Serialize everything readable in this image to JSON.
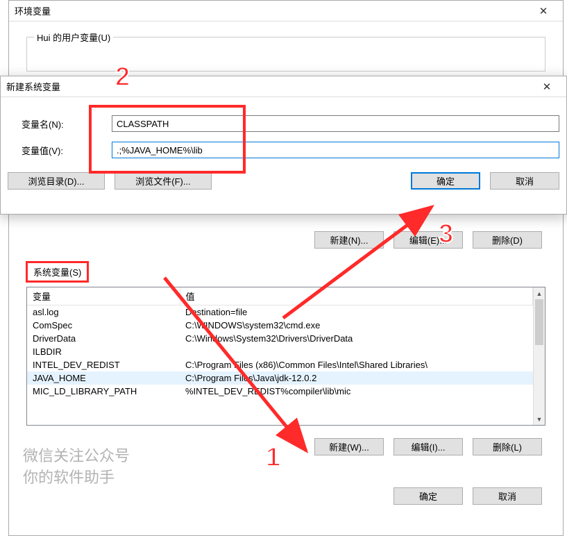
{
  "env_dialog": {
    "title": "环境变量",
    "user_section_label": "Hui 的用户变量(U)",
    "user_buttons": {
      "new": "新建(N)...",
      "edit": "编辑(E)...",
      "delete": "删除(D)"
    },
    "sys_section_label": "系统变量(S)",
    "sys_table": {
      "headers": {
        "name": "变量",
        "value": "值"
      },
      "rows": [
        {
          "name": "asl.log",
          "value": "Destination=file"
        },
        {
          "name": "ComSpec",
          "value": "C:\\WINDOWS\\system32\\cmd.exe"
        },
        {
          "name": "DriverData",
          "value": "C:\\Windows\\System32\\Drivers\\DriverData"
        },
        {
          "name": "ILBDIR",
          "value": ""
        },
        {
          "name": "INTEL_DEV_REDIST",
          "value": "C:\\Program Files (x86)\\Common Files\\Intel\\Shared Libraries\\"
        },
        {
          "name": "JAVA_HOME",
          "value": "C:\\Program Files\\Java\\jdk-12.0.2",
          "selected": true
        },
        {
          "name": "MIC_LD_LIBRARY_PATH",
          "value": "%INTEL_DEV_REDIST%compiler\\lib\\mic"
        }
      ]
    },
    "sys_buttons": {
      "new": "新建(W)...",
      "edit": "编辑(I)...",
      "delete": "删除(L)"
    },
    "footer_buttons": {
      "ok": "确定",
      "cancel": "取消"
    }
  },
  "new_dialog": {
    "title": "新建系统变量",
    "name_label": "变量名(N):",
    "value_label": "变量值(V):",
    "name_value": "CLASSPATH",
    "value_value": ".;%JAVA_HOME%\\lib",
    "browse_dir": "浏览目录(D)...",
    "browse_file": "浏览文件(F)...",
    "ok": "确定",
    "cancel": "取消"
  },
  "annotations": {
    "badge1": "1",
    "badge2": "2",
    "badge3": "3"
  },
  "watermark": {
    "line1": "微信关注公众号",
    "line2": "你的软件助手"
  }
}
